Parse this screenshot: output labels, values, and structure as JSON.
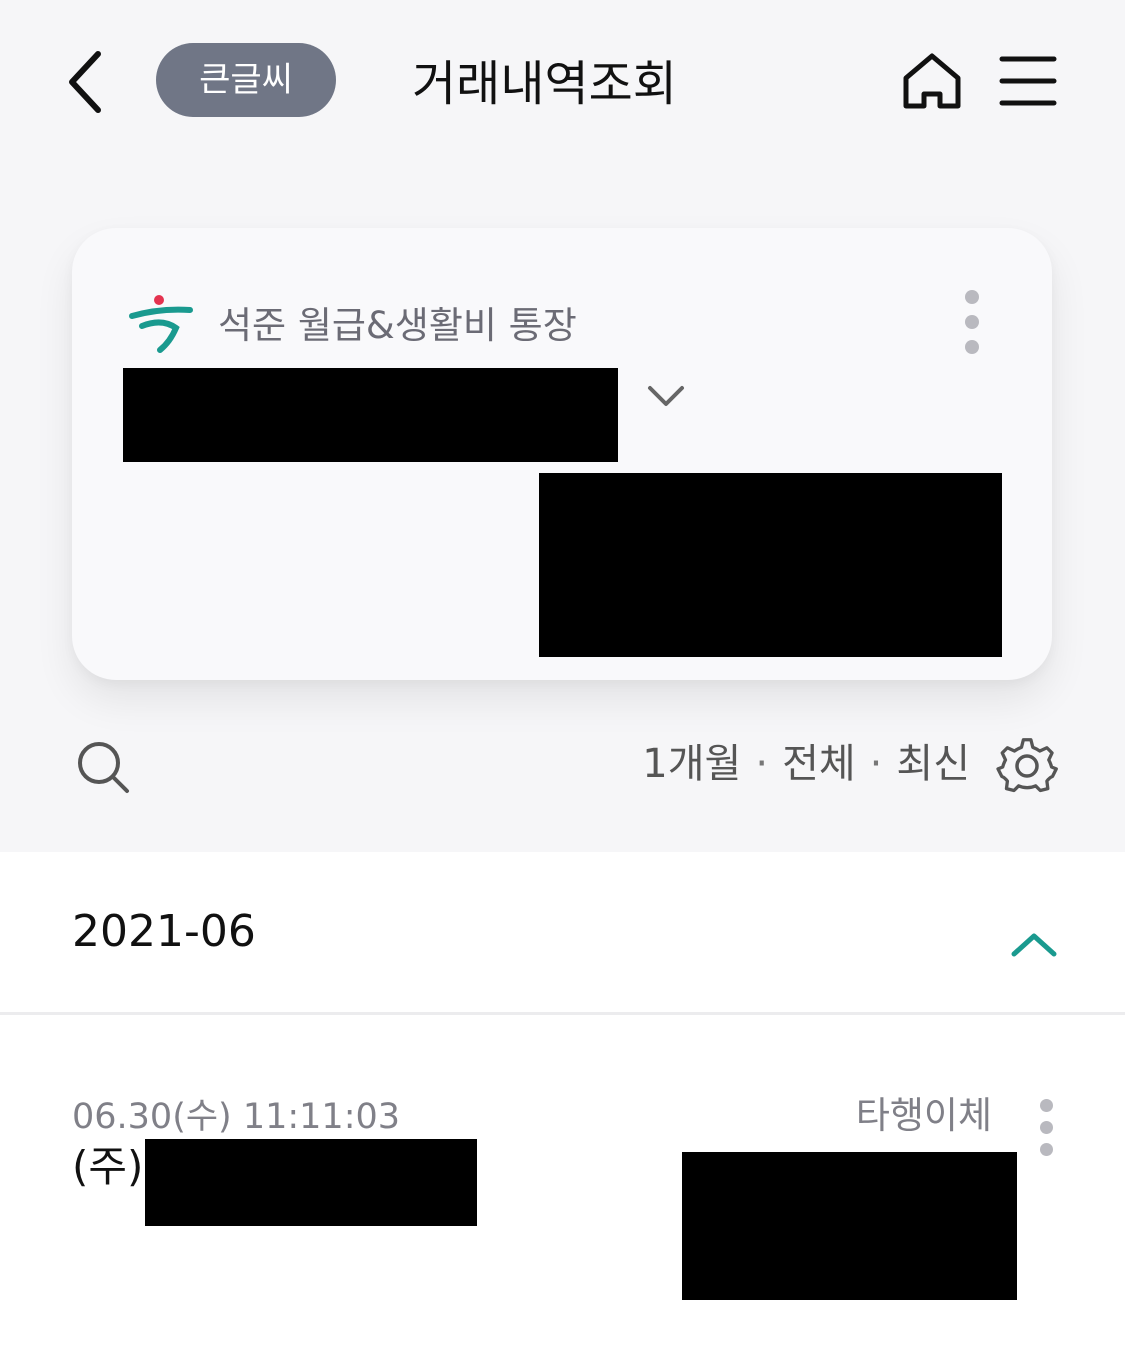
{
  "header": {
    "large_font_label": "큰글씨",
    "title": "거래내역조회",
    "icons": {
      "back": "chevron-left-icon",
      "home": "home-icon",
      "menu": "hamburger-menu-icon"
    }
  },
  "account_card": {
    "account_name": "석준 월급&생활비 통장",
    "bank_logo": "hana-bank-logo",
    "more_icon": "vertical-dots-icon",
    "dropdown_icon": "chevron-down-icon"
  },
  "filter_bar": {
    "period": "1개월",
    "type": "전체",
    "order": "최신",
    "separator": "·",
    "search_icon": "search-icon",
    "settings_icon": "gear-icon"
  },
  "month_section": {
    "label": "2021-06",
    "collapse_icon": "chevron-up-icon",
    "accent_color": "#1a9a8f"
  },
  "transactions": [
    {
      "datetime": "06.30(수) 11:11:03",
      "type": "타행이체",
      "name_prefix": "(주)"
    }
  ],
  "colors": {
    "large_font_button_bg": "#707686",
    "top_background": "#f6f6f8",
    "logo_teal": "#1a9a8f",
    "logo_red": "#e4334f"
  }
}
